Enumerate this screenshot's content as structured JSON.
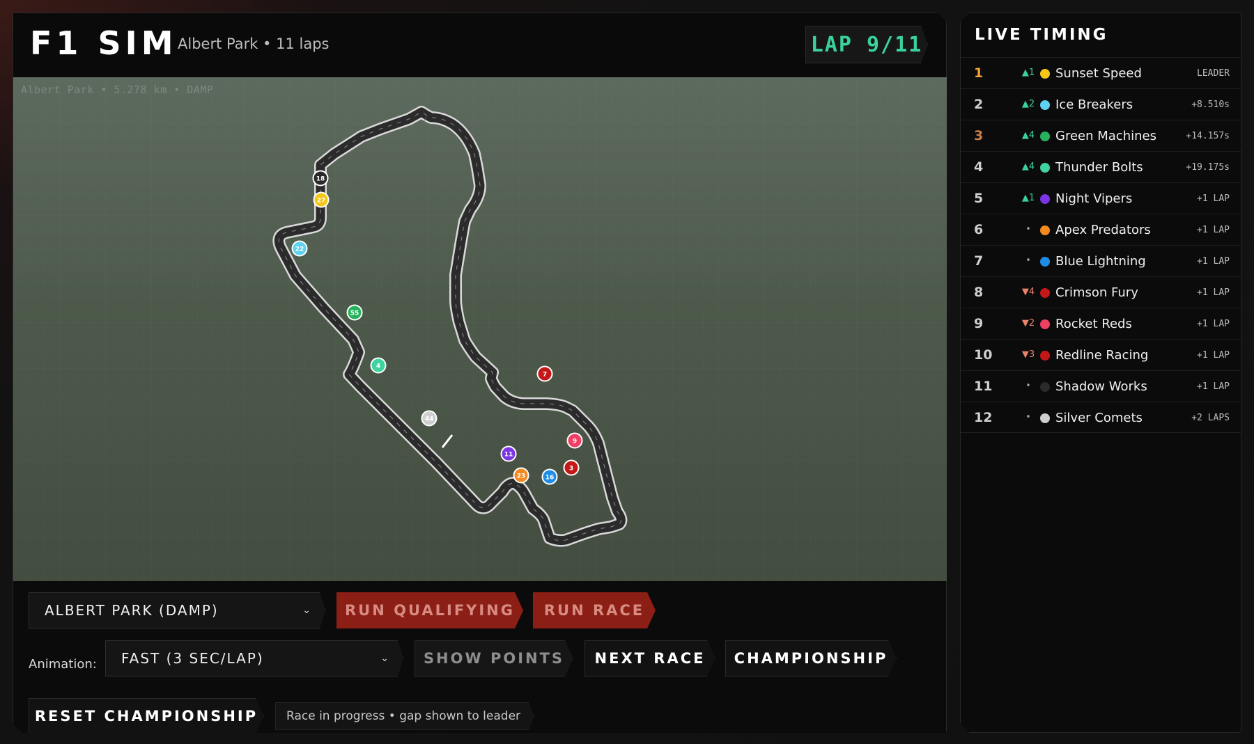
{
  "app": {
    "title": "F1 SIM",
    "subtitle": "Albert Park • 11 laps",
    "lap": "LAP 9/11"
  },
  "track": {
    "caption": "Albert Park • 5.278 km • DAMP",
    "cars": [
      {
        "number": "18",
        "color": "#2a2a2a"
      },
      {
        "number": "27",
        "color": "#f5c518"
      },
      {
        "number": "22",
        "color": "#5ed0f0"
      },
      {
        "number": "55",
        "color": "#27b35e"
      },
      {
        "number": "4",
        "color": "#3ed3a0"
      },
      {
        "number": "44",
        "color": "#cfcfcf"
      },
      {
        "number": "7",
        "color": "#c41818"
      },
      {
        "number": "9",
        "color": "#ef3f62"
      },
      {
        "number": "3",
        "color": "#c41818"
      },
      {
        "number": "16",
        "color": "#1f8de8"
      },
      {
        "number": "23",
        "color": "#f4891f"
      },
      {
        "number": "11",
        "color": "#7b35e4"
      }
    ]
  },
  "controls": {
    "track_select": "ALBERT PARK (DAMP)",
    "run_qualifying": "RUN QUALIFYING",
    "run_race": "RUN RACE",
    "animation_label": "Animation:",
    "animation_select": "FAST (3 SEC/LAP)",
    "show_points": "SHOW POINTS",
    "next_race": "NEXT RACE",
    "championship": "CHAMPIONSHIP",
    "reset_championship": "RESET CHAMPIONSHIP",
    "status": "Race in progress • gap shown to leader"
  },
  "timing": {
    "title": "LIVE TIMING",
    "rows": [
      {
        "pos": "1",
        "change": "▲1",
        "dir": "up",
        "team": "Sunset Speed",
        "color": "#f5c518",
        "gap": "LEADER"
      },
      {
        "pos": "2",
        "change": "▲2",
        "dir": "up",
        "team": "Ice Breakers",
        "color": "#5ed0f0",
        "gap": "+8.510s"
      },
      {
        "pos": "3",
        "change": "▲4",
        "dir": "up",
        "team": "Green Machines",
        "color": "#27b35e",
        "gap": "+14.157s"
      },
      {
        "pos": "4",
        "change": "▲4",
        "dir": "up",
        "team": "Thunder Bolts",
        "color": "#3ed3a0",
        "gap": "+19.175s"
      },
      {
        "pos": "5",
        "change": "▲1",
        "dir": "up",
        "team": "Night Vipers",
        "color": "#7b35e4",
        "gap": "+1 LAP"
      },
      {
        "pos": "6",
        "change": "•",
        "dir": "same",
        "team": "Apex Predators",
        "color": "#f4891f",
        "gap": "+1 LAP"
      },
      {
        "pos": "7",
        "change": "•",
        "dir": "same",
        "team": "Blue Lightning",
        "color": "#1f8de8",
        "gap": "+1 LAP"
      },
      {
        "pos": "8",
        "change": "▼4",
        "dir": "down",
        "team": "Crimson Fury",
        "color": "#c41818",
        "gap": "+1 LAP"
      },
      {
        "pos": "9",
        "change": "▼2",
        "dir": "down",
        "team": "Rocket Reds",
        "color": "#ef3f62",
        "gap": "+1 LAP"
      },
      {
        "pos": "10",
        "change": "▼3",
        "dir": "down",
        "team": "Redline Racing",
        "color": "#c41818",
        "gap": "+1 LAP"
      },
      {
        "pos": "11",
        "change": "•",
        "dir": "same",
        "team": "Shadow Works",
        "color": "#2a2a2a",
        "gap": "+1 LAP"
      },
      {
        "pos": "12",
        "change": "•",
        "dir": "same",
        "team": "Silver Comets",
        "color": "#cfcfcf",
        "gap": "+2 LAPS"
      }
    ]
  }
}
